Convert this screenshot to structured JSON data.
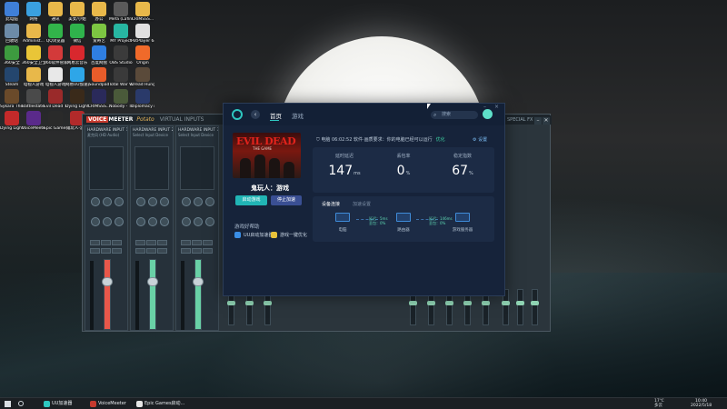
{
  "desktop": {
    "icons": [
      {
        "label": "此电脑",
        "color": "#3f7fd8"
      },
      {
        "label": "网络",
        "color": "#3aa0e0"
      },
      {
        "label": "通讯",
        "color": "#e8b84a"
      },
      {
        "label": "美女/小姐",
        "color": "#e8b84a"
      },
      {
        "label": "办公",
        "color": "#e8b84a"
      },
      {
        "label": "Mefa (Lafinit...",
        "color": "#5a5a5a"
      },
      {
        "label": "CRIMSSS...",
        "color": "#e8b84a"
      },
      {
        "label": "回收站",
        "color": "#6d8ba8"
      },
      {
        "label": "Administ...",
        "color": "#e8b84a"
      },
      {
        "label": "QQ浏览器",
        "color": "#32b44a"
      },
      {
        "label": "微信",
        "color": "#2fb34c"
      },
      {
        "label": "爱奇艺",
        "color": "#7dc642"
      },
      {
        "label": "MY Project",
        "color": "#27b7a2"
      },
      {
        "label": "PotPlayer 64 bit",
        "color": "#e0e0e0"
      },
      {
        "label": "360安全",
        "color": "#3d9b3f"
      },
      {
        "label": "360安全卫士",
        "color": "#e9c537"
      },
      {
        "label": "360软件管家",
        "color": "#d33a3a"
      },
      {
        "label": "网易云音乐",
        "color": "#d8282e"
      },
      {
        "label": "百度网盘",
        "color": "#2f7fe2"
      },
      {
        "label": "OBS Studio",
        "color": "#3b3b3b"
      },
      {
        "label": "Origin",
        "color": "#f06a2a"
      },
      {
        "label": "Steam",
        "color": "#24466e"
      },
      {
        "label": "电视人游戏",
        "color": "#e8b84a"
      },
      {
        "label": "电视人游戏",
        "color": "#e8e8e8"
      },
      {
        "label": "网易UU加速器",
        "color": "#2ea6e8"
      },
      {
        "label": "Soundpad",
        "color": "#e85c2a"
      },
      {
        "label": "Total War WARHAM...",
        "color": "#3a3a3a"
      },
      {
        "label": "Dread Hunger",
        "color": "#5a4a3a"
      },
      {
        "label": "Sykara The Win...",
        "color": "#6a4a2a"
      },
      {
        "label": "Battlestate Escape fr...",
        "color": "#4a4a4a"
      },
      {
        "label": "Evil Dead The Game",
        "color": "#9a2a2a"
      },
      {
        "label": "Dying Light 2",
        "color": "#3a2a1a"
      },
      {
        "label": "CRIMSSS...",
        "color": "#2a2a5a"
      },
      {
        "label": "Nobody - The Turna...",
        "color": "#4a5a3a"
      },
      {
        "label": "Diplomacy is Not a...",
        "color": "#2a3a6a"
      },
      {
        "label": "Dying Light 2",
        "color": "#c42a2a"
      },
      {
        "label": "VoiceMeeter",
        "color": "#5a2a8a"
      },
      {
        "label": "Epic Games Launcher",
        "color": "#2a2a2a"
      },
      {
        "label": "鬼玩人-游戏",
        "color": "#b22a2a"
      }
    ]
  },
  "voicemeeter": {
    "brand_voice": "VOICE",
    "brand_meeter": "MEETER",
    "brand_potato": "Potato",
    "virtual_label": "VIRTUAL INPUTS",
    "special_fx": "SPECIAL FX",
    "strips": [
      {
        "title": "HARDWARE INPUT 1",
        "sub": "麦克风 (HD Audio)",
        "fader_color": "#e8574a"
      },
      {
        "title": "HARDWARE INPUT 2",
        "sub": "Select Input Device",
        "fader_color": "#69d1a6"
      },
      {
        "title": "HARDWARE INPUT 3",
        "sub": "Select Input Device",
        "fader_color": "#69d1a6"
      }
    ]
  },
  "booster": {
    "tabs": [
      "首页",
      "游戏"
    ],
    "search_placeholder": "搜索",
    "status_line": "电脑 06:02:52  软件·画质要求：你的电脑已经可以运行",
    "status_link": "优化",
    "settings": "设置",
    "cover_title": "EVIL DEAD",
    "cover_subtitle": "THE GAME",
    "game_title": "鬼玩人：游戏",
    "launch_label": "启动游戏",
    "stop_label": "停止加速",
    "accessories_label": "游戏好帮助",
    "accessories": [
      {
        "label": "UU启动加速器",
        "color": "#3a8ee6"
      },
      {
        "label": "游戏一键优化",
        "color": "#e8c23a"
      }
    ],
    "stats": [
      {
        "label": "延时延迟",
        "value": "147",
        "unit": "ms"
      },
      {
        "label": "丢包率",
        "value": "0",
        "unit": "%"
      },
      {
        "label": "稳定指数",
        "value": "67",
        "unit": "%"
      }
    ],
    "net_tabs": [
      "设备连接",
      "加速设置"
    ],
    "net_nodes": [
      {
        "name": "电脑"
      },
      {
        "name": "路由器"
      },
      {
        "name": "游戏服务器"
      }
    ],
    "net_links": [
      {
        "line1": "延迟：5ms",
        "line2": "丢包：0%"
      },
      {
        "line1": "延迟：146ms",
        "line2": "丢包：0%"
      }
    ]
  },
  "taskbar": {
    "apps": [
      {
        "label": "UU加速器",
        "color": "#2ec7c0",
        "active": true
      },
      {
        "label": "VoiceMeeter",
        "color": "#c63a2e",
        "active": false
      },
      {
        "label": "Epic Games启动...",
        "color": "#e6e6e6",
        "active": false
      }
    ],
    "tray_temp": "17℃",
    "tray_weather": "多云",
    "time": "10:40",
    "date": "2022/5/18"
  }
}
